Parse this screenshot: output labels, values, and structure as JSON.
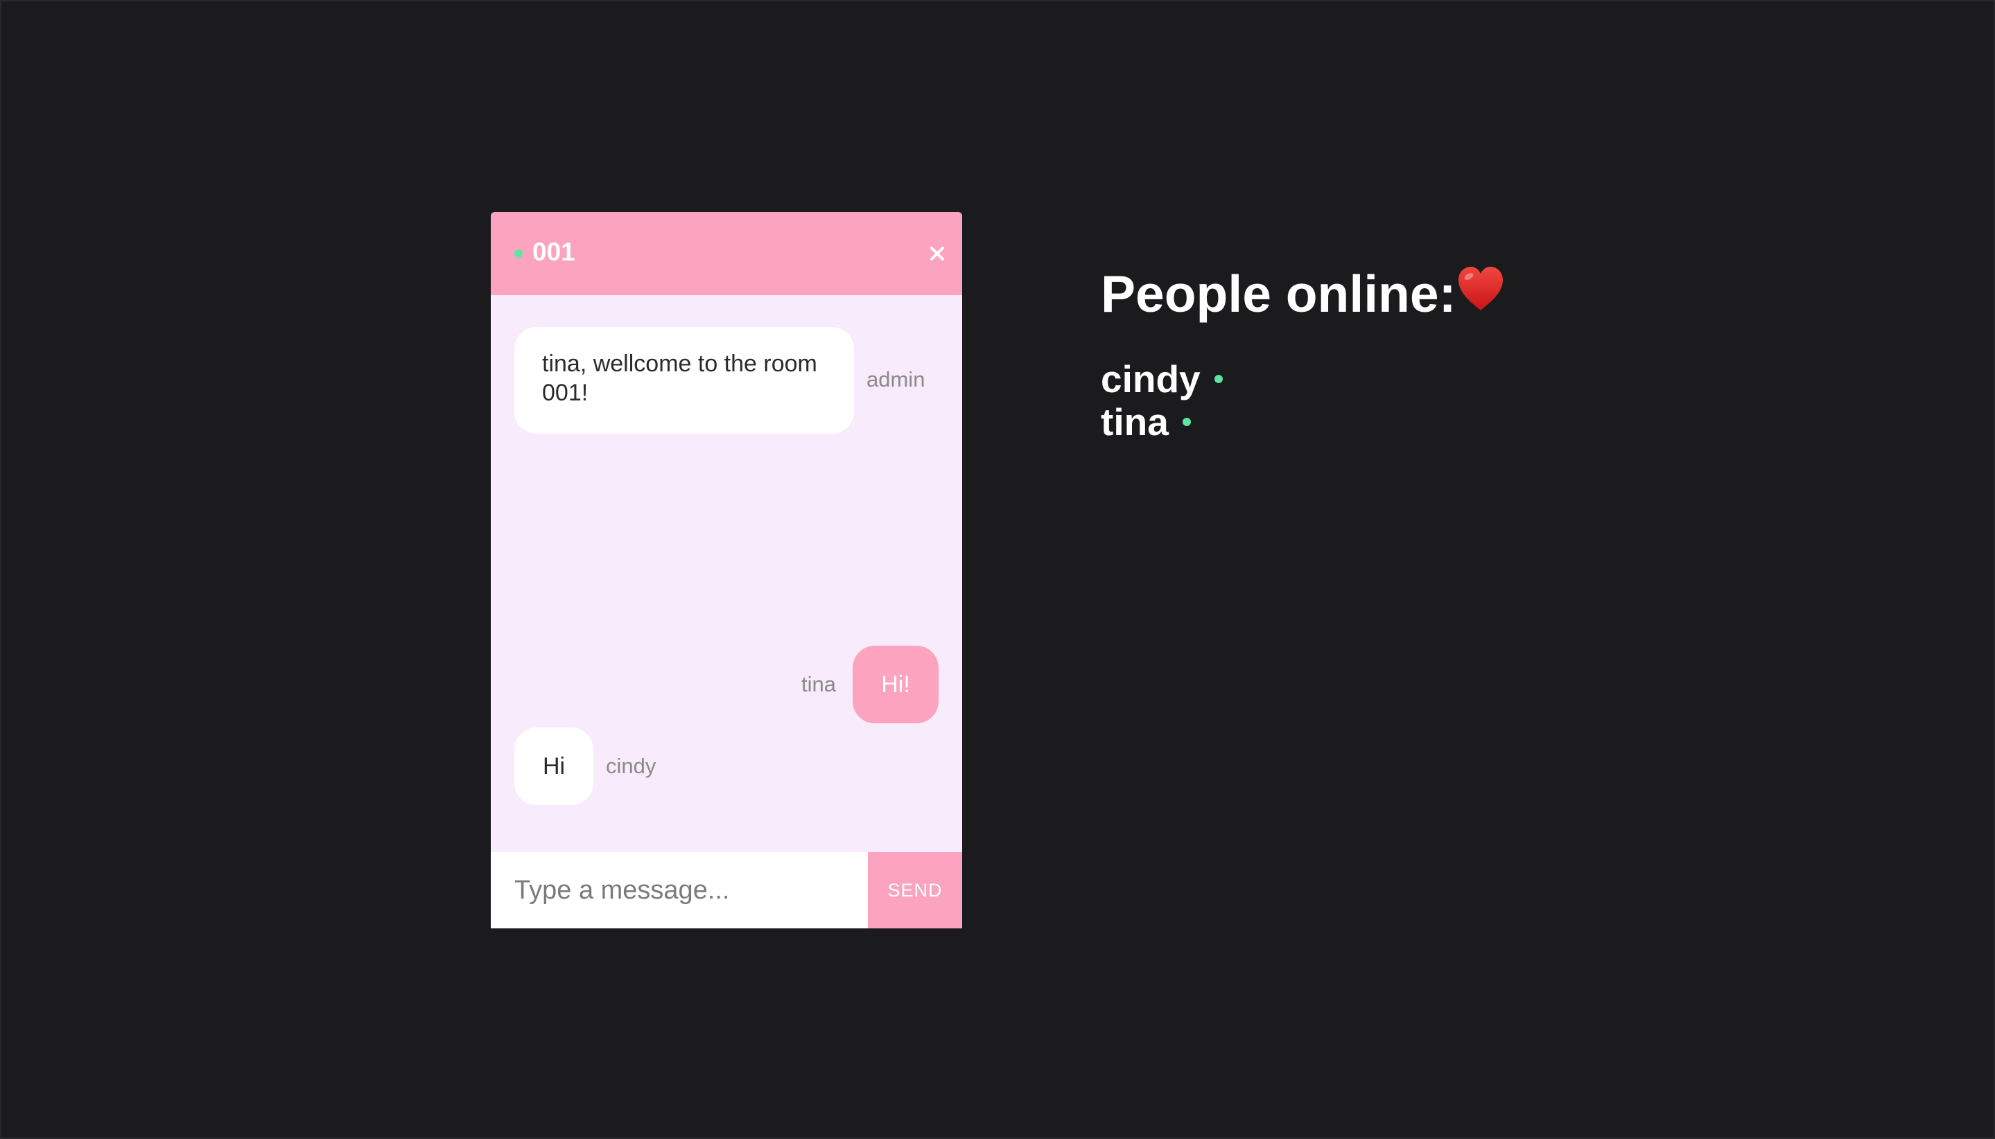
{
  "chat": {
    "room_name": "001",
    "close_symbol": "×",
    "messages": [
      {
        "sender": "admin",
        "text": "tina, wellcome to the room 001!",
        "side": "left"
      },
      {
        "sender": "tina",
        "text": "Hi!",
        "side": "right"
      },
      {
        "sender": "cindy",
        "text": "Hi",
        "side": "left"
      }
    ],
    "input_placeholder": "Type a message...",
    "input_value": "",
    "send_label": "SEND"
  },
  "people_online": {
    "title": "People online:",
    "icon": "heart-icon",
    "users": [
      "cindy",
      "tina"
    ]
  },
  "colors": {
    "background": "#1b1b1d",
    "accent_pink": "#fba3bf",
    "chat_body": "#f8ebfc",
    "online_green": "#5fe3a0"
  }
}
